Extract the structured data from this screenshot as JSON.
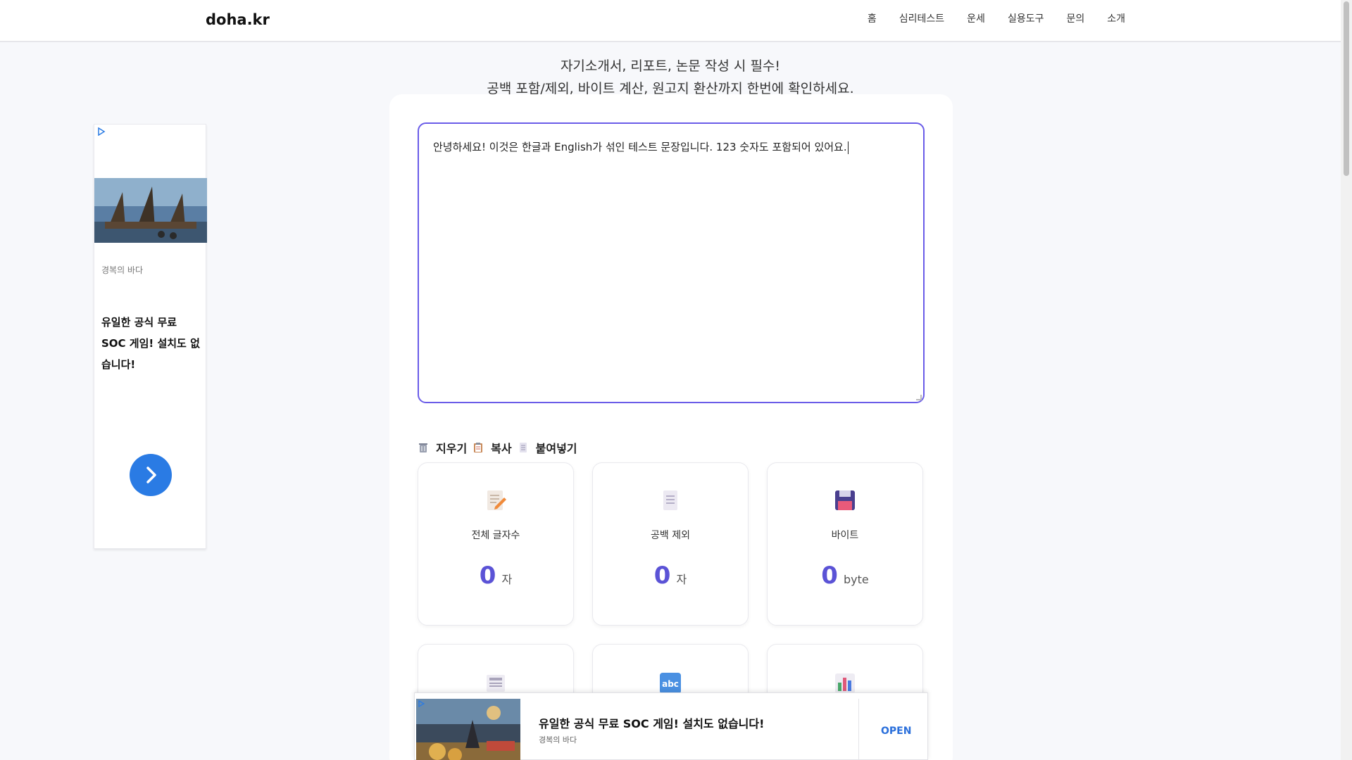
{
  "header": {
    "logo": "doha.kr",
    "nav": [
      "홈",
      "심리테스트",
      "운세",
      "실용도구",
      "문의",
      "소개"
    ]
  },
  "subtitle": {
    "line1": "자기소개서, 리포트, 논문 작성 시 필수!",
    "line2": "공백 포함/제외, 바이트 계산, 원고지 환산까지 한번에 확인하세요."
  },
  "editor": {
    "text": "안녕하세요! 이것은 한글과 English가 섞인 테스트 문장입니다. 123 숫자도 포함되어 있어요."
  },
  "toolbar": {
    "clear_label": "지우기",
    "copy_label": "복사",
    "paste_label": "붙여넣기"
  },
  "stats": [
    {
      "label": "전체 글자수",
      "value": "0",
      "unit": "자",
      "icon": "memo-icon"
    },
    {
      "label": "공백 제외",
      "value": "0",
      "unit": "자",
      "icon": "page-icon"
    },
    {
      "label": "바이트",
      "value": "0",
      "unit": "byte",
      "icon": "floppy-disk-icon"
    }
  ],
  "stats_row2_icons": [
    "newspaper-icon",
    "abc-icon",
    "bar-chart-icon"
  ],
  "side_ad": {
    "source": "경복의 바다",
    "headline": "유일한 공식 무료 SOC 게임! 설치도 없습니다!"
  },
  "bottom_ad": {
    "headline": "유일한 공식 무료 SOC 게임! 설치도 없습니다!",
    "source": "경복의 바다",
    "open_label": "OPEN"
  },
  "colors": {
    "accent": "#5b53d6",
    "border_focus": "#6a5ce8",
    "ad_button": "#2a7be4"
  }
}
